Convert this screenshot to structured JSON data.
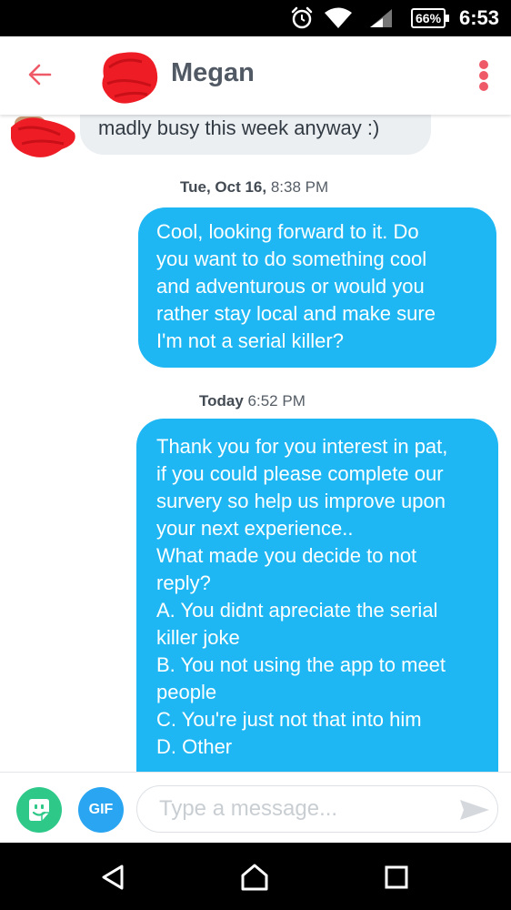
{
  "status_bar": {
    "battery": "66%",
    "time": "6:53",
    "icons": [
      "alarm-icon",
      "wifi-icon",
      "signal-icon",
      "battery-icon"
    ]
  },
  "header": {
    "contact_name": "Megan",
    "back_icon": "arrow-left-icon",
    "menu_icon": "more-vertical-icon",
    "accent_color": "#ef5a68"
  },
  "messages": {
    "incoming": {
      "text": "madly busy this week anyway :)"
    },
    "timestamps": [
      {
        "day": "Tue, Oct 16,",
        "time": "8:38 PM"
      },
      {
        "day": "Today",
        "time": "6:52 PM"
      }
    ],
    "outgoing_1": {
      "lines": [
        "Cool, looking forward to it. Do",
        "you want to do something cool",
        "and adventurous or would you",
        "rather stay local and make sure",
        "I'm not a serial killer?"
      ]
    },
    "outgoing_2": {
      "lines": [
        "Thank you for you interest in pat,",
        "if you could please complete our",
        "survery so help us improve upon",
        "your next experience..",
        "What made you decide to not",
        "reply?",
        "A. You didnt apreciate the serial",
        "killer joke",
        "B. You not using the app to meet",
        "people",
        "C. You're just not that into him",
        "D. Other"
      ]
    },
    "bubble_color_out": "#1eb7f3",
    "bubble_color_in": "#eceff2"
  },
  "composer": {
    "sticker_icon": "sticker-face-icon",
    "gif_label": "GIF",
    "placeholder": "Type a message...",
    "send_icon": "send-icon"
  },
  "nav_bar": {
    "icons": [
      "nav-back-icon",
      "nav-home-icon",
      "nav-recent-apps-icon"
    ]
  }
}
